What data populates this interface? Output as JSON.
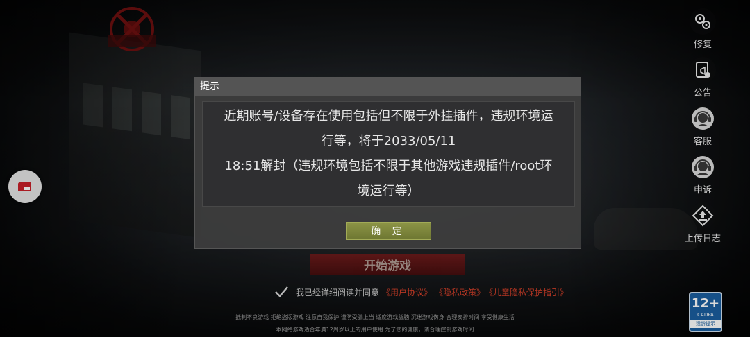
{
  "side_menu": {
    "items": [
      {
        "label": "修复",
        "icon": "gear-icon"
      },
      {
        "label": "公告",
        "icon": "announcement-icon"
      },
      {
        "label": "客服",
        "icon": "headset-icon"
      },
      {
        "label": "申诉",
        "icon": "headset-icon"
      },
      {
        "label": "上传日志",
        "icon": "upload-icon"
      }
    ]
  },
  "dialog": {
    "title": "提示",
    "message_lines": [
      "近期账号/设备存在使用包括但不限于外挂插件，违规环境运",
      "行等，将于2033/05/11",
      "18:51解封（违规环境包括不限于其他游戏违规插件/root环",
      "境运行等）"
    ],
    "confirm_label": "确 定"
  },
  "start_button": "开始游戏",
  "agreement": {
    "text": "我已经详细阅读并同意",
    "links": [
      "《用户协议》",
      "《隐私政策》",
      "《儿童隐私保护指引》"
    ]
  },
  "footer": {
    "line1": "抵制不良游戏  拒绝盗版游戏  注意自我保护  谨防受骗上当  适度游戏益脑  沉迷游戏伤身  合理安排时间  享受健康生活",
    "line2": "本网络游戏适合年满12周岁以上的用户使用     为了您的健康，请合理控制游戏时间"
  },
  "age_rating": {
    "number": "12+",
    "org": "CADPA",
    "label": "适龄提示"
  },
  "colors": {
    "link": "#d6402a",
    "confirm": "#7f883c",
    "badge": "#1a5fa0"
  }
}
